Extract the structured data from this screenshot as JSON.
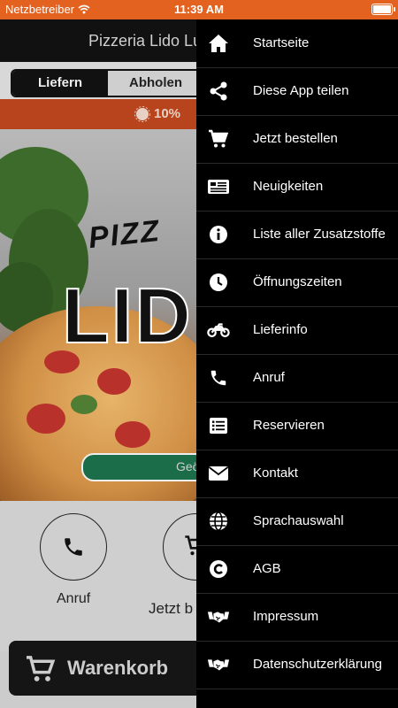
{
  "status_bar": {
    "carrier": "Netzbetreiber",
    "time": "11:39 AM"
  },
  "app": {
    "title": "Pizzeria Lido Lu",
    "segment": {
      "delivery_label": "Liefern",
      "pickup_label": "Abholen"
    },
    "promo_text": "10%",
    "hero": {
      "logo_small": "PIZZ",
      "logo_big": "LID",
      "open_status": "Geö"
    },
    "quick_actions": [
      {
        "label": "Anruf"
      },
      {
        "label": "Jetzt b"
      }
    ],
    "cart": {
      "label": "Warenkorb"
    }
  },
  "drawer": {
    "items": [
      {
        "label": "Startseite",
        "icon": "home-icon"
      },
      {
        "label": "Diese App teilen",
        "icon": "share-icon"
      },
      {
        "label": "Jetzt bestellen",
        "icon": "cart-icon"
      },
      {
        "label": "Neuigkeiten",
        "icon": "news-icon"
      },
      {
        "label": "Liste aller Zusatzstoffe",
        "icon": "info-icon"
      },
      {
        "label": "Öffnungszeiten",
        "icon": "clock-icon"
      },
      {
        "label": "Lieferinfo",
        "icon": "motorcycle-icon"
      },
      {
        "label": "Anruf",
        "icon": "phone-icon"
      },
      {
        "label": "Reservieren",
        "icon": "list-icon"
      },
      {
        "label": "Kontakt",
        "icon": "envelope-icon"
      },
      {
        "label": "Sprachauswahl",
        "icon": "globe-icon"
      },
      {
        "label": "AGB",
        "icon": "copyright-icon"
      },
      {
        "label": "Impressum",
        "icon": "handshake-icon"
      },
      {
        "label": "Datenschutzerklärung",
        "icon": "handshake-icon"
      }
    ]
  },
  "colors": {
    "status_bar": "#e3621f",
    "drawer_bg": "#000000",
    "promo": "#b8441d",
    "open_pill": "#1b6c49"
  }
}
